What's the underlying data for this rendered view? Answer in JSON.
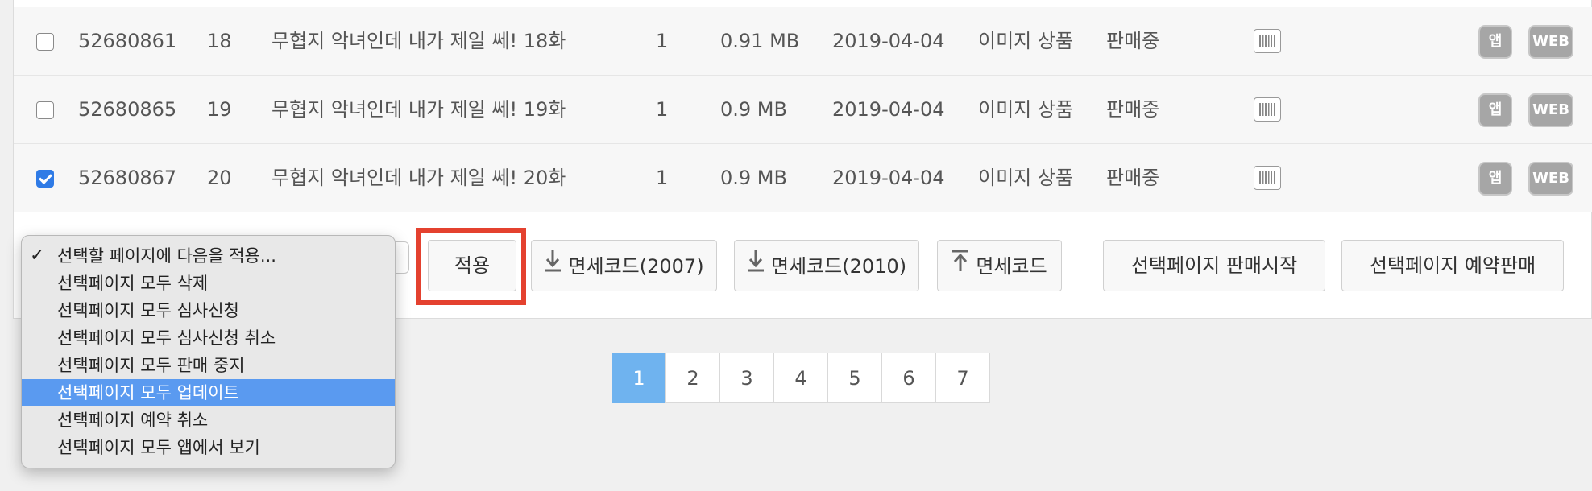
{
  "table": {
    "rows": [
      {
        "checked": false,
        "id": "52680861",
        "no": "18",
        "title": "무협지 악녀인데 내가 제일 쎄! 18화",
        "count": "1",
        "size": "0.91 MB",
        "date": "2019-04-04",
        "type": "이미지 상품",
        "status": "판매중",
        "app_label": "앱",
        "web_label": "WEB"
      },
      {
        "checked": false,
        "id": "52680865",
        "no": "19",
        "title": "무협지 악녀인데 내가 제일 쎄! 19화",
        "count": "1",
        "size": "0.9 MB",
        "date": "2019-04-04",
        "type": "이미지 상품",
        "status": "판매중",
        "app_label": "앱",
        "web_label": "WEB"
      },
      {
        "checked": true,
        "id": "52680867",
        "no": "20",
        "title": "무협지 악녀인데 내가 제일 쎄! 20화",
        "count": "1",
        "size": "0.9 MB",
        "date": "2019-04-04",
        "type": "이미지 상품",
        "status": "판매중",
        "app_label": "앱",
        "web_label": "WEB"
      }
    ]
  },
  "toolbar": {
    "apply_label": "적용",
    "dl_2007_label": "면세코드(2007)",
    "dl_2010_label": "면세코드(2010)",
    "upload_label": "면세코드",
    "start_sale_label": "선택페이지 판매시작",
    "reserve_sale_label": "선택페이지 예약판매"
  },
  "dropdown": {
    "selected_index": 0,
    "highlighted_index": 5,
    "options": [
      "선택할 페이지에 다음을 적용...",
      "선택페이지 모두 삭제",
      "선택페이지 모두 심사신청",
      "선택페이지 모두 심사신청 취소",
      "선택페이지 모두 판매 중지",
      "선택페이지 모두 업데이트",
      "선택페이지 예약 취소",
      "선택페이지 모두 앱에서 보기"
    ]
  },
  "pagination": {
    "current": "1",
    "pages": [
      "1",
      "2",
      "3",
      "4",
      "5",
      "6",
      "7"
    ]
  },
  "colors": {
    "checkbox_checked": "#2f7be6",
    "highlight_frame": "#e4412f",
    "dropdown_highlight": "#5a9af0",
    "page_active": "#6fb3ef"
  }
}
